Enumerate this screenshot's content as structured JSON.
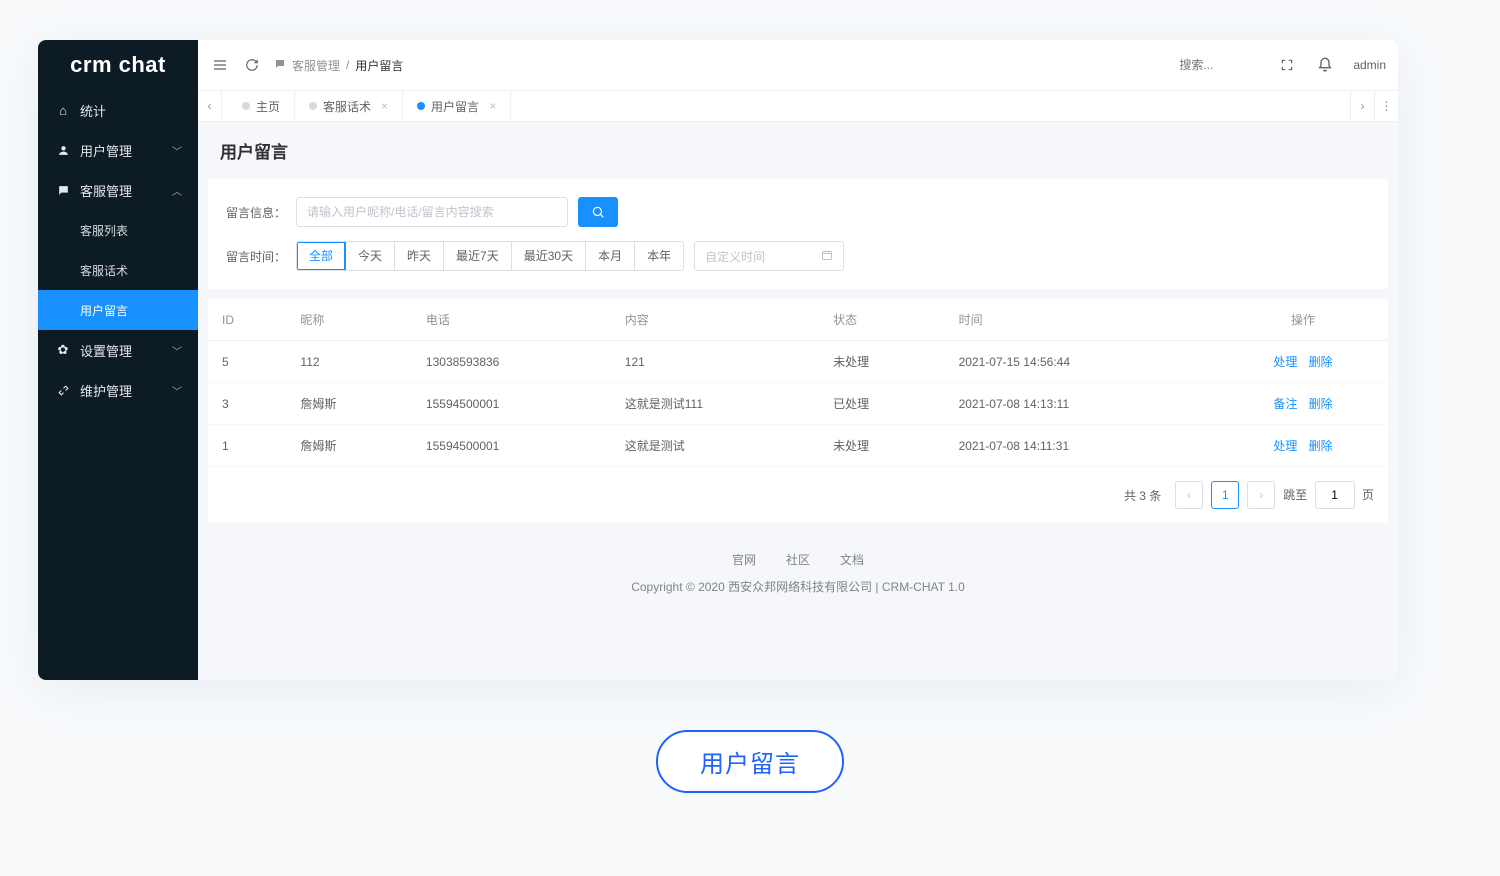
{
  "logo": "crm chat",
  "sidebar": {
    "items": [
      {
        "icon": "home",
        "label": "统计",
        "hasCaret": false
      },
      {
        "icon": "user",
        "label": "用户管理",
        "hasCaret": true,
        "caret": "down"
      },
      {
        "icon": "chat",
        "label": "客服管理",
        "hasCaret": true,
        "caret": "up",
        "children": [
          {
            "label": "客服列表",
            "active": false
          },
          {
            "label": "客服话术",
            "active": false
          },
          {
            "label": "用户留言",
            "active": true
          }
        ]
      },
      {
        "icon": "gear",
        "label": "设置管理",
        "hasCaret": true,
        "caret": "down"
      },
      {
        "icon": "wrench",
        "label": "维护管理",
        "hasCaret": true,
        "caret": "down"
      }
    ]
  },
  "topbar": {
    "breadcrumb_icon": "chat",
    "breadcrumb": [
      "客服管理",
      "用户留言"
    ],
    "search_placeholder": "搜索...",
    "user": "admin"
  },
  "tabs": [
    {
      "label": "主页",
      "active": false,
      "closable": false
    },
    {
      "label": "客服话术",
      "active": false,
      "closable": true
    },
    {
      "label": "用户留言",
      "active": true,
      "closable": true
    }
  ],
  "page": {
    "title": "用户留言",
    "filter": {
      "kw_label": "留言信息：",
      "kw_placeholder": "请输入用户昵称/电话/留言内容搜索",
      "time_label": "留言时间：",
      "segments": [
        "全部",
        "今天",
        "昨天",
        "最近7天",
        "最近30天",
        "本月",
        "本年"
      ],
      "active_segment": "全部",
      "custom_time_placeholder": "自定义时间"
    },
    "table": {
      "headers": [
        "ID",
        "昵称",
        "电话",
        "内容",
        "状态",
        "时间",
        "操作"
      ],
      "rows": [
        {
          "id": "5",
          "nick": "112",
          "phone": "13038593836",
          "content": "121",
          "status": "未处理",
          "time": "2021-07-15 14:56:44",
          "ops": [
            "处理",
            "删除"
          ]
        },
        {
          "id": "3",
          "nick": "詹姆斯",
          "phone": "15594500001",
          "content": "这就是测试111",
          "status": "已处理",
          "time": "2021-07-08 14:13:11",
          "ops": [
            "备注",
            "删除"
          ]
        },
        {
          "id": "1",
          "nick": "詹姆斯",
          "phone": "15594500001",
          "content": "这就是测试",
          "status": "未处理",
          "time": "2021-07-08 14:11:31",
          "ops": [
            "处理",
            "删除"
          ]
        }
      ]
    },
    "pagination": {
      "total_text": "共 3 条",
      "current": "1",
      "jump_label_before": "跳至",
      "jump_value": "1",
      "jump_label_after": "页"
    }
  },
  "footer": {
    "links": [
      "官网",
      "社区",
      "文档"
    ],
    "copyright": "Copyright © 2020 西安众邦网络科技有限公司 | CRM-CHAT 1.0"
  },
  "pill": "用户留言"
}
